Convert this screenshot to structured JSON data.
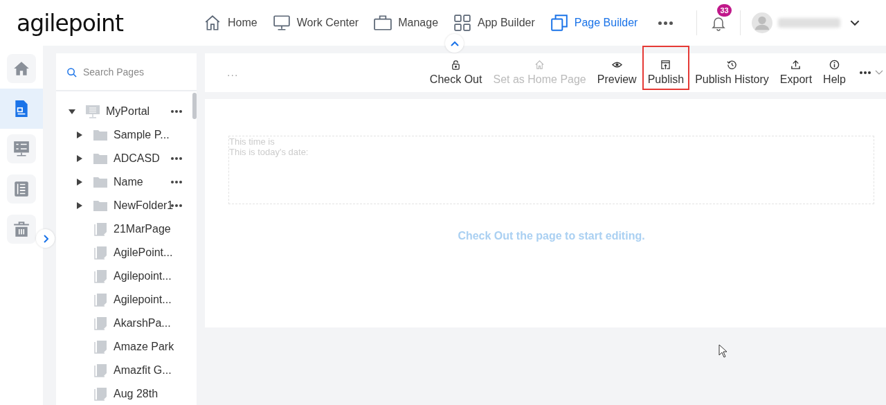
{
  "header": {
    "logo": "agilepoint",
    "nav": [
      {
        "label": "Home",
        "selected": false
      },
      {
        "label": "Work Center",
        "selected": false
      },
      {
        "label": "Manage",
        "selected": false
      },
      {
        "label": "App Builder",
        "selected": false
      },
      {
        "label": "Page Builder",
        "selected": true
      }
    ],
    "notifications": "33"
  },
  "rail": [
    {
      "selected": false
    },
    {
      "selected": true
    },
    {
      "selected": false
    },
    {
      "selected": false
    },
    {
      "selected": false
    }
  ],
  "search": {
    "placeholder": "Search Pages"
  },
  "tree": [
    {
      "label": "MyPortal",
      "kind": "portal",
      "expanded": true,
      "menu": true,
      "children": [
        {
          "label": "Sample P...",
          "kind": "folder",
          "menu": false
        },
        {
          "label": "ADCASD",
          "kind": "folder",
          "menu": true
        },
        {
          "label": "Name",
          "kind": "folder",
          "menu": true
        },
        {
          "label": "NewFolder1",
          "kind": "folder",
          "menu": true
        },
        {
          "label": "21MarPage",
          "kind": "page",
          "menu": false
        },
        {
          "label": "AgilePoint...",
          "kind": "page",
          "menu": false
        },
        {
          "label": "Agilepoint...",
          "kind": "page",
          "menu": false
        },
        {
          "label": "Agilepoint...",
          "kind": "page",
          "menu": false
        },
        {
          "label": "AkarshPa...",
          "kind": "page",
          "menu": false
        },
        {
          "label": "Amaze Park",
          "kind": "page",
          "menu": false
        },
        {
          "label": "Amazfit G...",
          "kind": "page",
          "menu": false
        },
        {
          "label": "Aug 28th",
          "kind": "page",
          "menu": false
        }
      ]
    }
  ],
  "toolbar": {
    "overflow": "...",
    "actions": [
      {
        "label": "Check Out",
        "disabled": false,
        "highlighted": false
      },
      {
        "label": "Set as Home Page",
        "disabled": true,
        "highlighted": false
      },
      {
        "label": "Preview",
        "disabled": false,
        "highlighted": false
      },
      {
        "label": "Publish",
        "disabled": false,
        "highlighted": true
      },
      {
        "label": "Publish History",
        "disabled": false,
        "highlighted": false
      },
      {
        "label": "Export",
        "disabled": false,
        "highlighted": false
      },
      {
        "label": "Help",
        "disabled": false,
        "highlighted": false
      }
    ]
  },
  "canvas": {
    "lines": [
      "This time is",
      "This is today's date:"
    ],
    "message": "Check Out the page to start editing."
  }
}
